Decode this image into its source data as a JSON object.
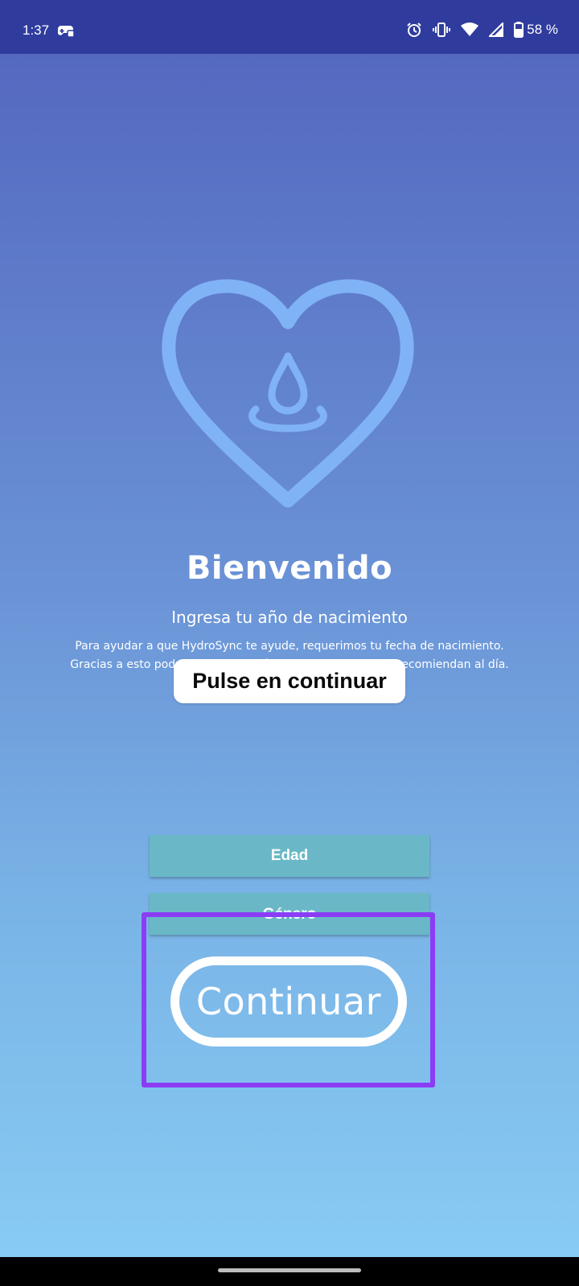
{
  "status_bar": {
    "time": "1:37",
    "battery_percent": "58 %",
    "icons": [
      "game-controller-icon",
      "alarm-icon",
      "vibrate-icon",
      "wifi-icon",
      "signal-icon",
      "battery-icon"
    ]
  },
  "colors": {
    "status_bar": "#2f3c9e",
    "background_top": "#5264bd",
    "background_bottom": "#89cdf4",
    "logo": "#80b2f6",
    "field_button": "#6ab8c7",
    "highlight": "#8b3df5",
    "text": "#ffffff"
  },
  "welcome": {
    "title": "Bienvenido",
    "subtitle": "Ingresa tu año de nacimiento",
    "description_line1": "Para ayudar a que HydroSync te ayude, requerimos tu fecha de nacimiento.",
    "description_line2": "Gracias a esto podremos saber cuántos vasos de agua te recomiendan al día."
  },
  "tooltip": {
    "text": "Pulse en continuar"
  },
  "form": {
    "age_label": "Edad",
    "gender_label": "Género"
  },
  "continue_button": {
    "label": "Continuar"
  }
}
